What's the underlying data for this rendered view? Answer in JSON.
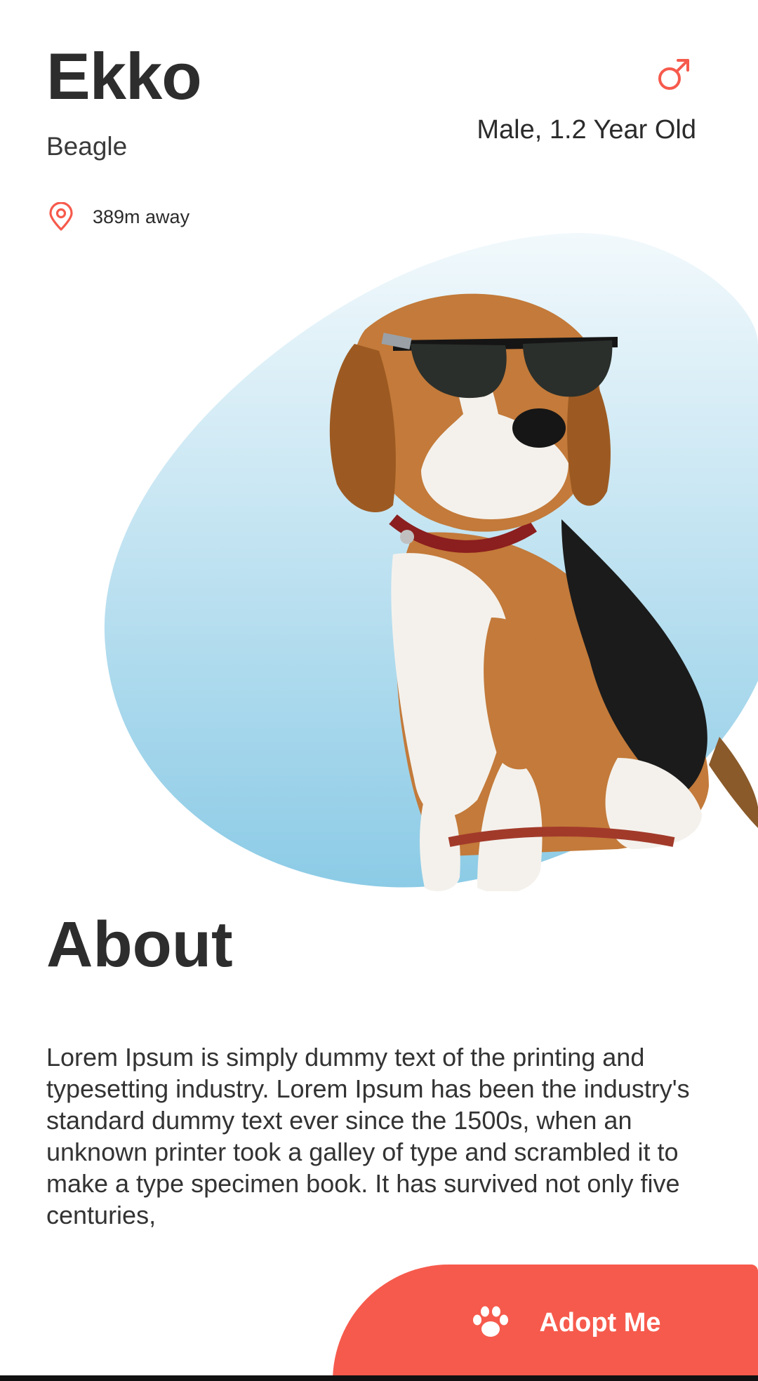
{
  "pet": {
    "name": "Ekko",
    "breed": "Beagle",
    "gender_age": "Male, 1.2 Year Old",
    "distance": "389m away"
  },
  "about": {
    "title": "About",
    "text": "Lorem Ipsum is simply dummy text of the printing and typesetting industry. Lorem Ipsum has been the industry's standard dummy text ever since the 1500s, when an unknown printer took a galley of type and scrambled it to make a type specimen book. It has survived not only five centuries,"
  },
  "actions": {
    "adopt_label": "Adopt Me"
  },
  "icons": {
    "gender": "male-symbol-icon",
    "location": "location-pin-icon",
    "adopt": "paw-icon"
  },
  "colors": {
    "accent": "#f65a4c",
    "blob_top": "#eef7fb",
    "blob_bottom": "#8ccbe6",
    "text": "#2d2d2d"
  }
}
